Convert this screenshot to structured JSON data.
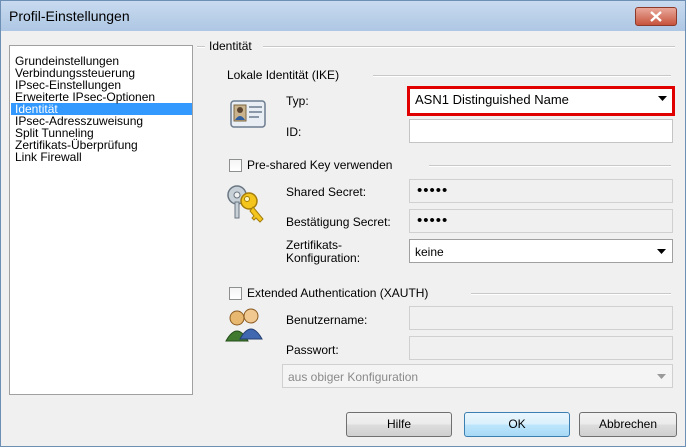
{
  "window": {
    "title": "Profil-Einstellungen"
  },
  "nav": {
    "items": [
      {
        "label": "Grundeinstellungen",
        "active": false
      },
      {
        "label": "Verbindungssteuerung",
        "active": false
      },
      {
        "label": "IPsec-Einstellungen",
        "active": false
      },
      {
        "label": "Erweiterte IPsec-Optionen",
        "active": false
      },
      {
        "label": "Identität",
        "active": true
      },
      {
        "label": "IPsec-Adresszuweisung",
        "active": false
      },
      {
        "label": "Split Tunneling",
        "active": false
      },
      {
        "label": "Zertifikats-Überprüfung",
        "active": false
      },
      {
        "label": "Link Firewall",
        "active": false
      }
    ]
  },
  "identity": {
    "section_title": "Identität",
    "local_group_title": "Lokale Identität (IKE)",
    "type_label": "Typ:",
    "type_value": "ASN1 Distinguished Name",
    "id_label": "ID:",
    "id_value": ""
  },
  "psk": {
    "checkbox_label": "Pre-shared Key verwenden",
    "checked": false,
    "shared_secret_label": "Shared Secret:",
    "shared_secret_value": "•••••",
    "confirm_label": "Bestätigung Secret:",
    "confirm_value": "•••••",
    "cert_config_label_line1": "Zertifikats-",
    "cert_config_label_line2": "Konfiguration:",
    "cert_config_value": "keine"
  },
  "xauth": {
    "checkbox_label": "Extended Authentication (XAUTH)",
    "checked": false,
    "username_label": "Benutzername:",
    "username_value": "",
    "password_label": "Passwort:",
    "password_value": "",
    "source_value": "aus obiger Konfiguration"
  },
  "buttons": {
    "help": "Hilfe",
    "ok": "OK",
    "cancel": "Abbrechen"
  }
}
